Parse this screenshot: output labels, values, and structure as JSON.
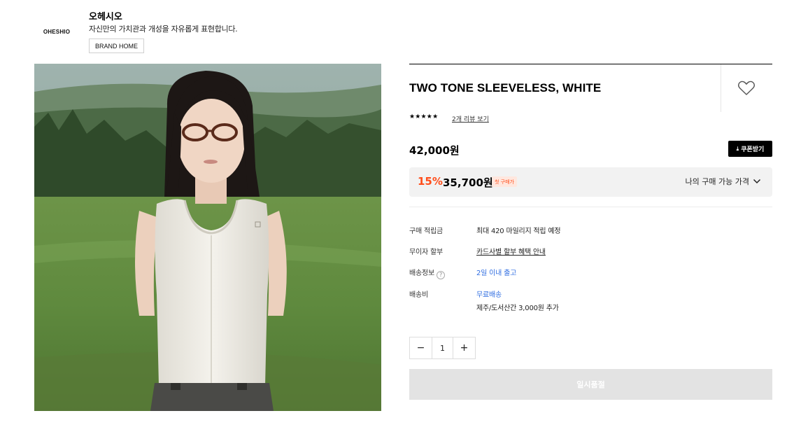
{
  "brand": {
    "logo_text": "OHESHIO",
    "name": "오헤시오",
    "description": "자신만의 가치관과 개성을 자유롭게 표현합니다.",
    "home_button": "BRAND HOME"
  },
  "product": {
    "title": "TWO TONE SLEEVELESS, WHITE",
    "rating_stars": "★★★★★",
    "review_link": "2개 리뷰 보기",
    "price": "42,000원",
    "coupon_button": "쿠폰받기",
    "discount_percent": "15%",
    "discount_price": "35,700원",
    "first_purchase_badge": "첫 구매가",
    "my_price_toggle": "나의 구매 가능 가격"
  },
  "info": {
    "points_label": "구매 적립금",
    "points_value": "최대 420 마일리지 적립 예정",
    "installment_label": "무이자 할부",
    "installment_value": "카드사별 할부 혜택 안내",
    "shipping_info_label": "배송정보",
    "shipping_info_help": "?",
    "shipping_info_value": "2일 이내 출고",
    "shipping_fee_label": "배송비",
    "shipping_fee_value": "무료배송",
    "shipping_fee_extra": "제주/도서산간 3,000원 추가"
  },
  "quantity": {
    "minus": "−",
    "value": "1",
    "plus": "+"
  },
  "purchase": {
    "button_label": "일시품절"
  },
  "colors": {
    "accent_discount": "#ff4d1a",
    "link_blue": "#2f6de1",
    "soldout_bg": "#e3e3e3"
  }
}
